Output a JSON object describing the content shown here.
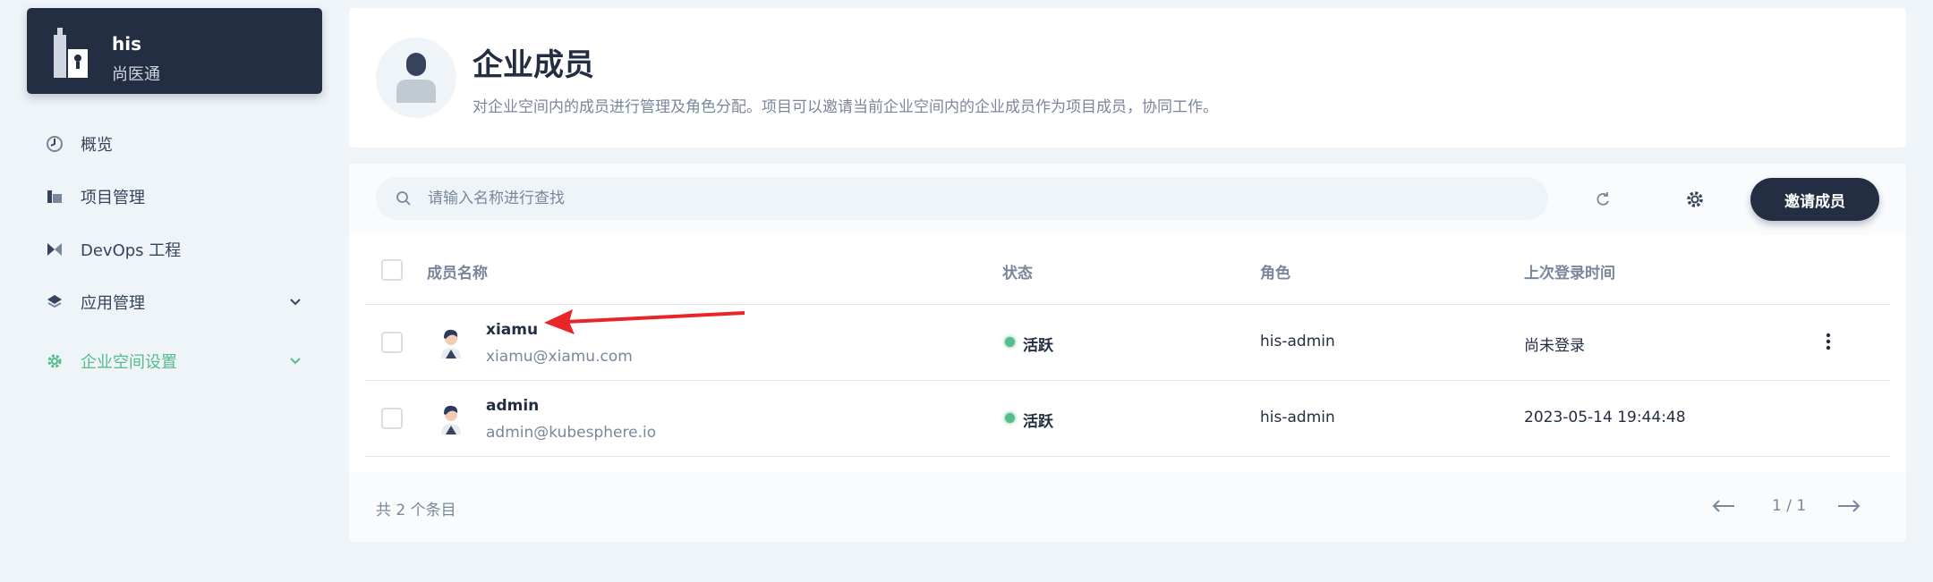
{
  "workspace": {
    "name": "his",
    "subtitle": "尚医通"
  },
  "sidebar": {
    "items": [
      {
        "label": "概览",
        "icon": "dashboard-icon"
      },
      {
        "label": "项目管理",
        "icon": "project-icon"
      },
      {
        "label": "DevOps 工程",
        "icon": "devops-icon"
      },
      {
        "label": "应用管理",
        "icon": "layers-icon",
        "expandable": true
      },
      {
        "label": "企业空间设置",
        "icon": "gear-icon",
        "expandable": true,
        "active": true
      }
    ]
  },
  "header": {
    "title": "企业成员",
    "description": "对企业空间内的成员进行管理及角色分配。项目可以邀请当前企业空间内的企业成员作为项目成员，协同工作。"
  },
  "toolbar": {
    "search_placeholder": "请输入名称进行查找",
    "invite_label": "邀请成员"
  },
  "table": {
    "columns": [
      "成员名称",
      "状态",
      "角色",
      "上次登录时间"
    ],
    "rows": [
      {
        "name": "xiamu",
        "email": "xiamu@xiamu.com",
        "status": "活跃",
        "role": "his-admin",
        "last_login": "尚未登录"
      },
      {
        "name": "admin",
        "email": "admin@kubesphere.io",
        "status": "活跃",
        "role": "his-admin",
        "last_login": "2023-05-14 19:44:48"
      }
    ]
  },
  "footer": {
    "total": "共 2 个条目",
    "page": "1 / 1"
  },
  "colors": {
    "primary_dark": "#242e42",
    "accent_green": "#55bc8a",
    "background": "#eff4f9",
    "annotation_red": "#e8262a"
  }
}
